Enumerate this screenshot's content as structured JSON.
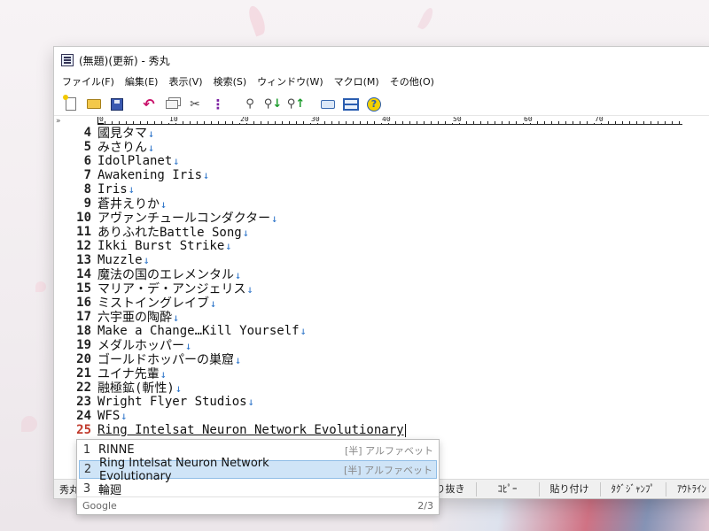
{
  "window": {
    "title": "(無題)(更新) - 秀丸"
  },
  "menu": [
    "ファイル(F)",
    "編集(E)",
    "表示(V)",
    "検索(S)",
    "ウィンドウ(W)",
    "マクロ(M)",
    "その他(O)"
  ],
  "toolbar": {
    "icons": [
      "new-file-icon",
      "open-folder-icon",
      "save-icon",
      "undo-icon",
      "copy-icon",
      "cut-icon",
      "paste-icon",
      "find-icon",
      "find-next-icon",
      "find-prev-icon",
      "tag-jump-icon",
      "window-icon",
      "help-icon"
    ]
  },
  "editor": {
    "gutter_mark": "»",
    "ruler_labels": [
      "0",
      "10",
      "20",
      "30",
      "40",
      "50",
      "60",
      "70"
    ],
    "eol_mark": "↓",
    "lines": [
      {
        "num": "4",
        "text": "國見タマ"
      },
      {
        "num": "5",
        "text": "みさりん"
      },
      {
        "num": "6",
        "text": "IdolPlanet"
      },
      {
        "num": "7",
        "text": "Awakening Iris"
      },
      {
        "num": "8",
        "text": "Iris"
      },
      {
        "num": "9",
        "text": "蒼井えりか"
      },
      {
        "num": "10",
        "text": "アヴァンチュールコンダクター"
      },
      {
        "num": "11",
        "text": "ありふれたBattle Song"
      },
      {
        "num": "12",
        "text": "Ikki Burst Strike"
      },
      {
        "num": "13",
        "text": "Muzzle"
      },
      {
        "num": "14",
        "text": "魔法の国のエレメンタル"
      },
      {
        "num": "15",
        "text": "マリア・デ・アンジェリス"
      },
      {
        "num": "16",
        "text": "ミストイングレイブ"
      },
      {
        "num": "17",
        "text": "六宇亜の陶酔"
      },
      {
        "num": "18",
        "text": "Make a Change…Kill Yourself"
      },
      {
        "num": "19",
        "text": "メダルホッパー"
      },
      {
        "num": "20",
        "text": "ゴールドホッパーの巣窟"
      },
      {
        "num": "21",
        "text": "ユイナ先輩"
      },
      {
        "num": "22",
        "text": "融極鉱(斬性)"
      },
      {
        "num": "23",
        "text": "Wright Flyer Studios"
      },
      {
        "num": "24",
        "text": "WFS"
      }
    ],
    "current_line": {
      "num": "25",
      "text": "Ring Intelsat Neuron Network Evolutionary"
    }
  },
  "statusbar": {
    "app": "秀丸",
    "keys": [
      "切り抜き",
      "ｺﾋﾟｰ",
      "貼り付け",
      "ﾀｸﾞｼﾞｬﾝﾌﾟ",
      "ｱｳﾄﾗｲﾝ"
    ]
  },
  "ime": {
    "candidates": [
      {
        "num": "1",
        "word": "RINNE",
        "type": "[半] アルファベット",
        "selected": false
      },
      {
        "num": "2",
        "word": "Ring Intelsat Neuron Network Evolutionary",
        "type": "[半] アルファベット",
        "selected": true
      },
      {
        "num": "3",
        "word": "輪廻",
        "type": "",
        "selected": false
      }
    ],
    "source": "Google",
    "page": "2/3"
  },
  "colors": {
    "eol": "#2a72c8",
    "current_line_num": "#c0392b",
    "selected_candidate": "#cfe4f7"
  }
}
